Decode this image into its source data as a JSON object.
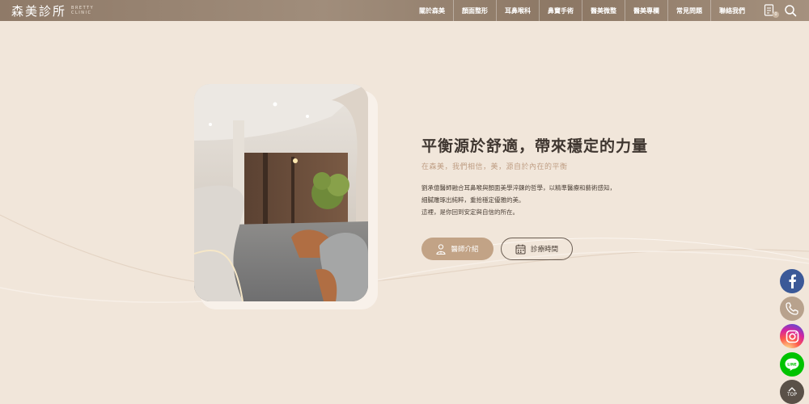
{
  "header": {
    "logo_cn": "森美診所",
    "logo_en_line1": "BRETTY",
    "logo_en_line2": "CLINIC",
    "nav": [
      {
        "label": "關於森美"
      },
      {
        "label": "顏面整形"
      },
      {
        "label": "耳鼻喉科"
      },
      {
        "label": "鼻竇手術"
      },
      {
        "label": "醫美微整"
      },
      {
        "label": "醫美專欄"
      },
      {
        "label": "常見問題"
      },
      {
        "label": "聯絡我們"
      }
    ],
    "icons": [
      "document-icon",
      "search-icon"
    ],
    "badge": "0"
  },
  "main": {
    "headline": "平衡源於舒適，帶來穩定的力量",
    "subhead": "在森美，我們相信，美，源自於內在的平衡",
    "body_lines": [
      "劉承億醫師融合耳鼻喉與顏面美學淬鍊的哲學，以精準醫療和藝術感知，",
      "細膩雕琢出純粹，重拾穩定優雅的美。",
      "這裡，是你回到安定與自信的所在。"
    ],
    "buttons": {
      "doctor": "醫師介紹",
      "hours": "診療時間"
    }
  },
  "floating": {
    "top_label": "TOP",
    "line_label": "LINE"
  },
  "colors": {
    "background": "#f1e6da",
    "header": "#998571",
    "accent": "#c2a386",
    "text": "#3f3630"
  }
}
